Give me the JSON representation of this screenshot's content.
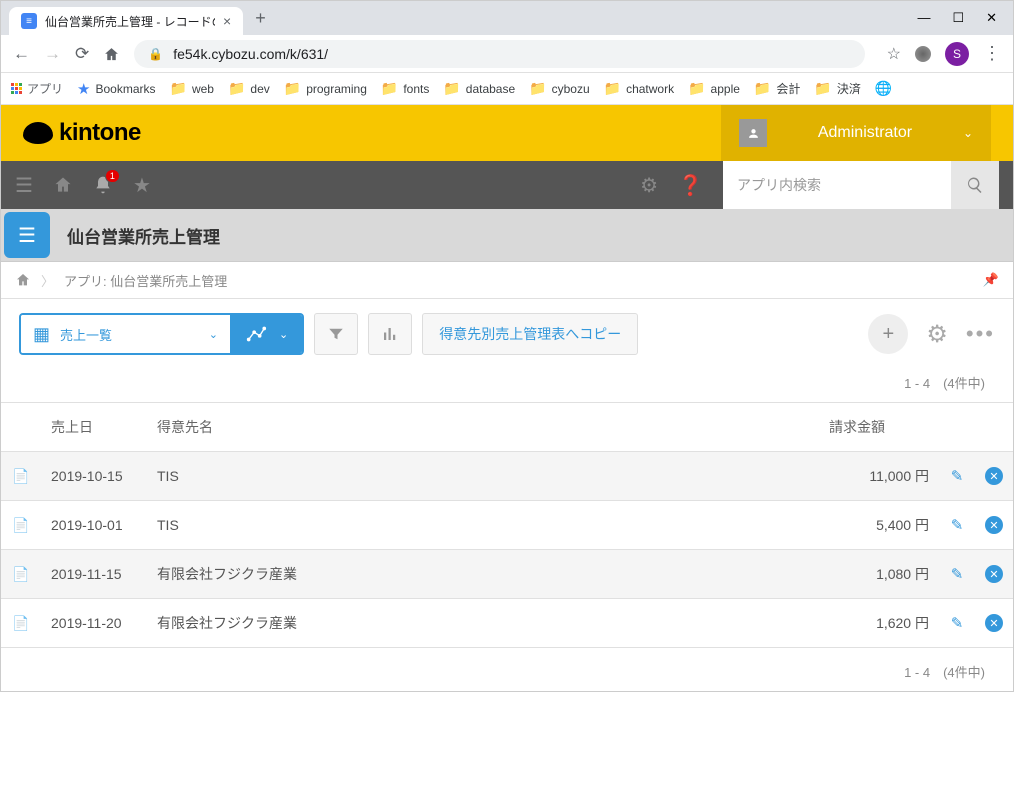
{
  "browser": {
    "tab_title": "仙台営業所売上管理 - レコードの一",
    "url": "fe54k.cybozu.com/k/631/",
    "profile_letter": "S",
    "bookmarks_apps": "アプリ",
    "bookmarks_star": "Bookmarks",
    "bookmark_folders": [
      "web",
      "dev",
      "programing",
      "fonts",
      "database",
      "cybozu",
      "chatwork",
      "apple",
      "会計",
      "決済"
    ]
  },
  "header": {
    "logo_text": "kintone",
    "username": "Administrator"
  },
  "toolbar": {
    "notification_badge": "1",
    "search_placeholder": "アプリ内検索"
  },
  "app": {
    "name": "仙台営業所売上管理",
    "breadcrumb": "アプリ: 仙台営業所売上管理"
  },
  "actions": {
    "view_name": "売上一覧",
    "copy_button": "得意先別売上管理表へコピー"
  },
  "paging": {
    "text": "1 - 4　(4件中)"
  },
  "table": {
    "headers": {
      "date": "売上日",
      "customer": "得意先名",
      "amount": "請求金額"
    },
    "rows": [
      {
        "date": "2019-10-15",
        "customer": "TIS",
        "amount": "11,000 円"
      },
      {
        "date": "2019-10-01",
        "customer": "TIS",
        "amount": "5,400 円"
      },
      {
        "date": "2019-11-15",
        "customer": "有限会社フジクラ産業",
        "amount": "1,080 円"
      },
      {
        "date": "2019-11-20",
        "customer": "有限会社フジクラ産業",
        "amount": "1,620 円"
      }
    ]
  }
}
